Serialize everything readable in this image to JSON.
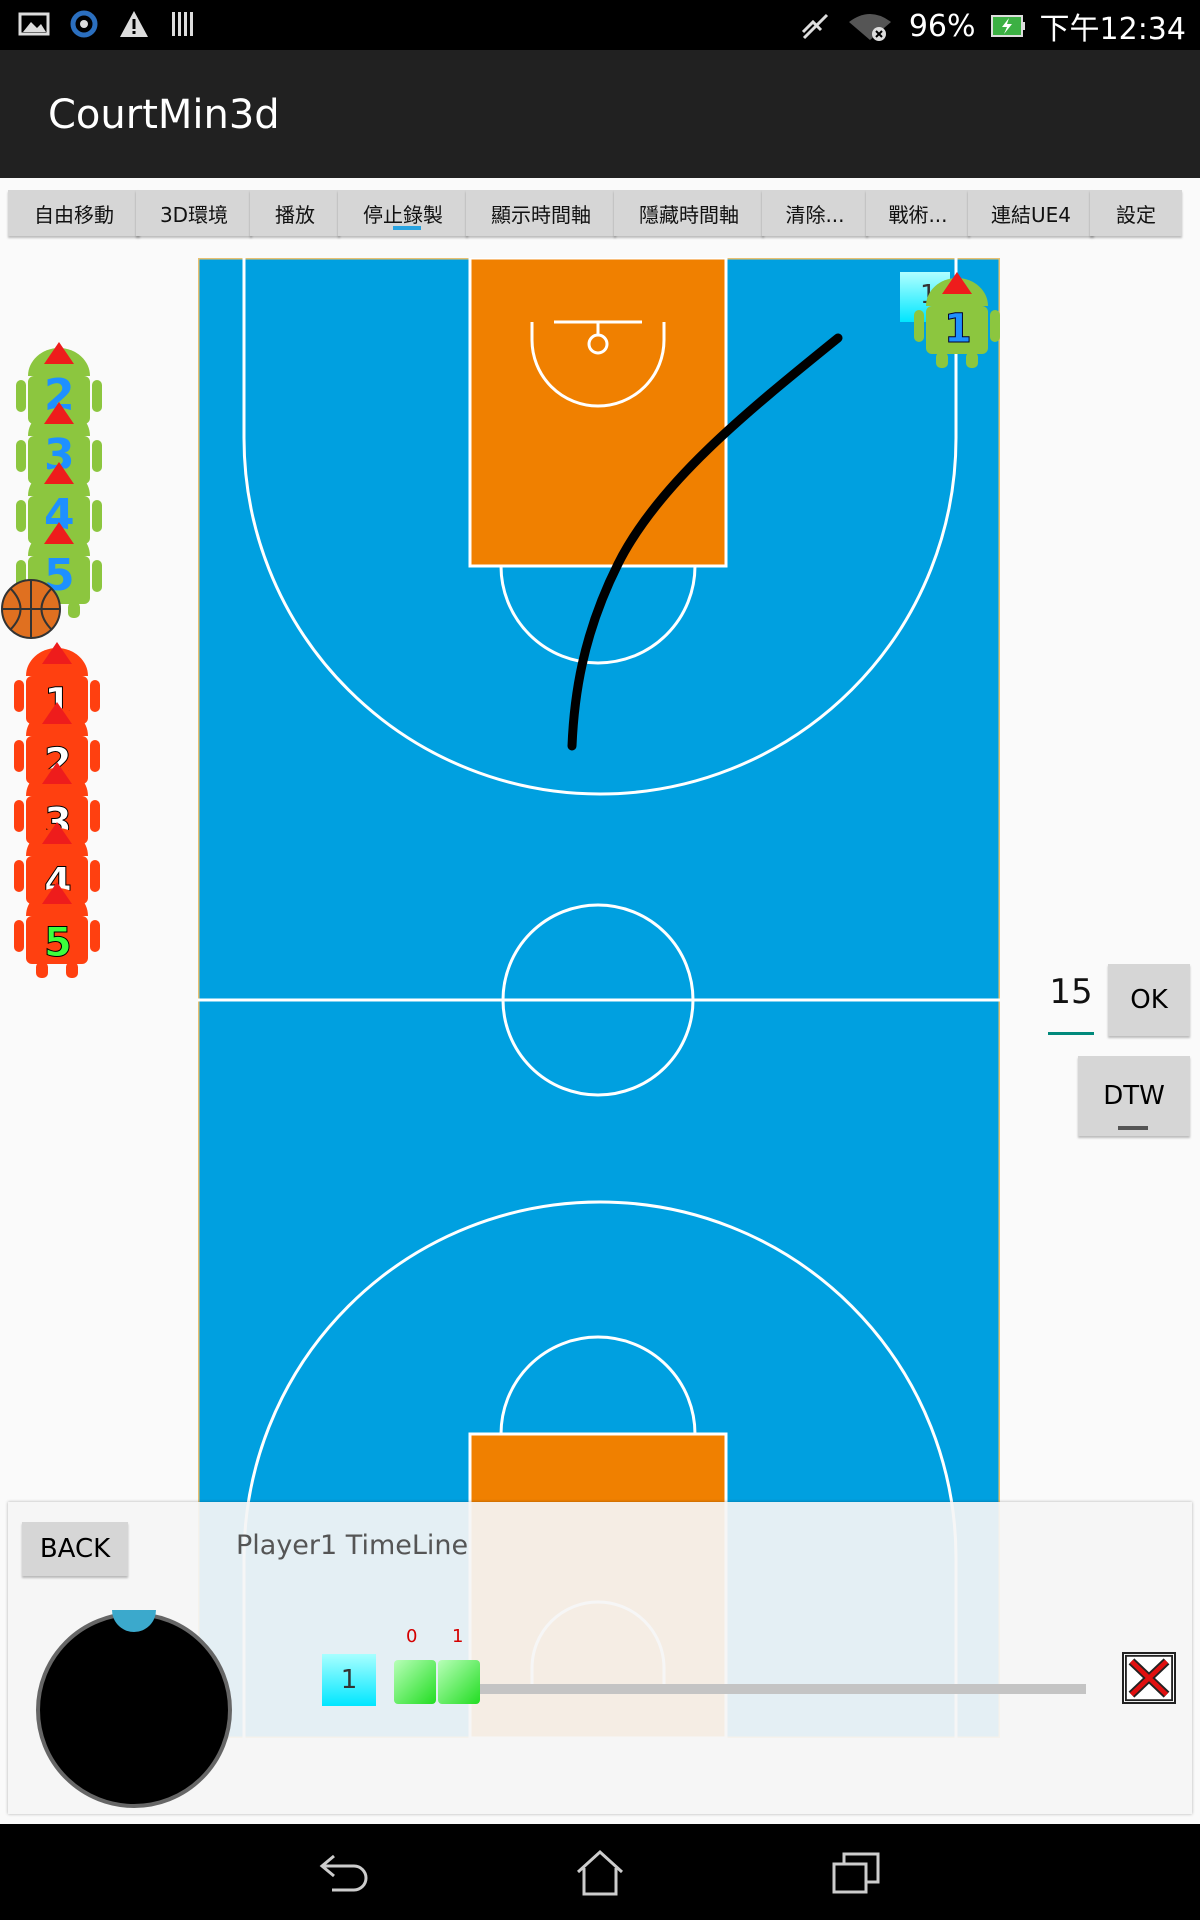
{
  "status_bar": {
    "battery": "96%",
    "time": "下午12:34",
    "icons": [
      "image-icon",
      "sync-icon",
      "warning-icon",
      "barcode-icon",
      "mute-icon",
      "wifi-icon",
      "battery-charging-icon"
    ]
  },
  "app": {
    "title": "CourtMin3d"
  },
  "toolbar": {
    "buttons": [
      {
        "label": "自由移動"
      },
      {
        "label": "3D環境"
      },
      {
        "label": "播放"
      },
      {
        "label": "停止錄製",
        "active": true
      },
      {
        "label": "顯示時間軸"
      },
      {
        "label": "隱藏時間軸"
      },
      {
        "label": "清除..."
      },
      {
        "label": "戰術..."
      },
      {
        "label": "連結UE4"
      },
      {
        "label": "設定"
      }
    ]
  },
  "court": {
    "floor_color": "#00a0e0",
    "paint_color": "#f08000",
    "court_player": {
      "number": "1",
      "tag": "1"
    }
  },
  "team_green": {
    "numbers": [
      "2",
      "3",
      "4",
      "5"
    ]
  },
  "team_red": {
    "numbers": [
      "1",
      "2",
      "3",
      "4",
      "5"
    ]
  },
  "controls": {
    "number_value": "15",
    "ok_label": "OK",
    "dtw_label": "DTW"
  },
  "timeline": {
    "back_label": "BACK",
    "title": "Player1 TimeLine",
    "player_chip": "1",
    "keyframes": [
      "0",
      "1"
    ]
  },
  "nav_bar": {
    "icons": [
      "back-icon",
      "home-icon",
      "recents-icon"
    ]
  }
}
